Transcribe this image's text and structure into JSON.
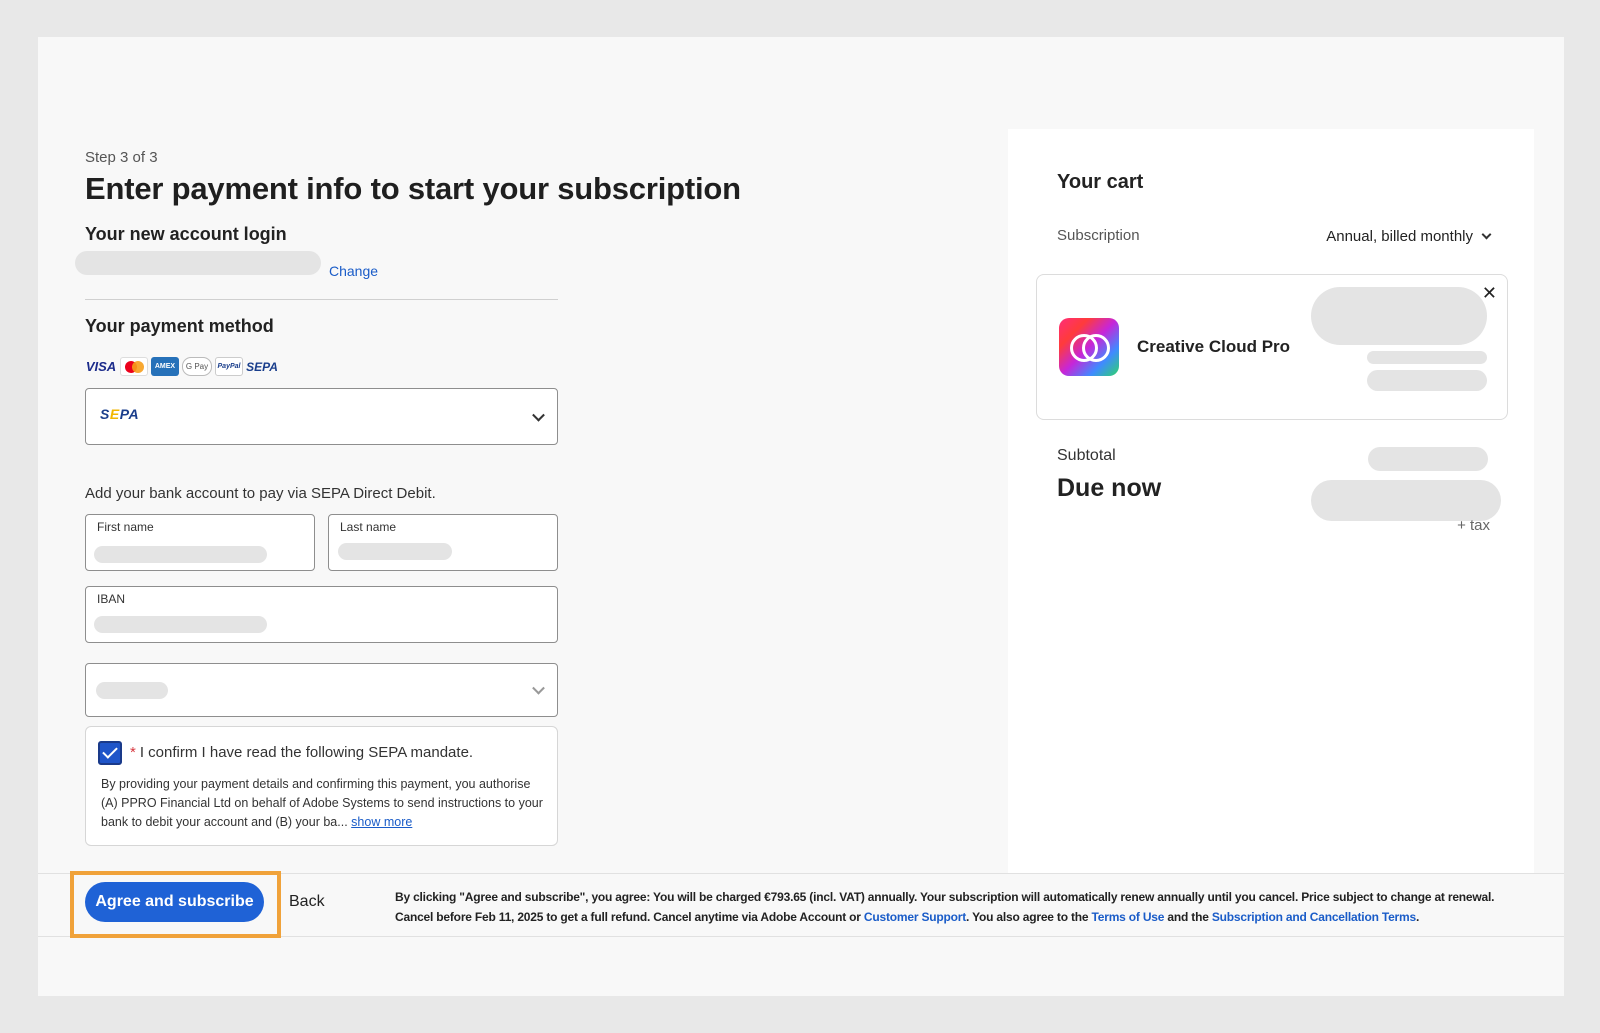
{
  "step": "Step 3 of 3",
  "title": "Enter payment info to start your subscription",
  "account": {
    "heading": "Your new account login",
    "change_label": "Change"
  },
  "payment": {
    "heading": "Your payment method",
    "logos": [
      "VISA",
      "Mastercard",
      "AMEX",
      "G Pay",
      "PayPal",
      "SEPA"
    ],
    "selected_method": "SEPA",
    "description": "Add your bank account to pay via SEPA Direct Debit.",
    "first_name_label": "First name",
    "last_name_label": "Last name",
    "iban_label": "IBAN"
  },
  "mandate": {
    "confirm_text": "I confirm I have read the following SEPA mandate.",
    "required_mark": "*",
    "body": "By providing your payment details and confirming this payment, you authorise (A) PPRO Financial Ltd on behalf of Adobe Systems to send instructions to your bank to debit your account and (B) your ba...",
    "show_more": "show more",
    "checked": true
  },
  "cart": {
    "title": "Your cart",
    "subscription_label": "Subscription",
    "subscription_value": "Annual, billed monthly",
    "product_name": "Creative Cloud Pro",
    "close_glyph": "✕",
    "subtotal_label": "Subtotal",
    "due_label": "Due now",
    "tax_label": "+ tax"
  },
  "footer": {
    "primary_label": "Agree and subscribe",
    "back_label": "Back",
    "legal_1": "By clicking \"Agree and subscribe\", you agree: You will be charged €793.65 (incl. VAT) annually. Your subscription will automatically renew annually until you cancel. Price subject to change at renewal. Cancel before Feb 11, 2025 to get a full refund. Cancel anytime via Adobe Account or ",
    "link_support": "Customer Support",
    "legal_2": ". You also agree to the ",
    "link_terms": "Terms of Use",
    "legal_3": " and the ",
    "link_cancel": "Subscription and Cancellation Terms",
    "legal_4": "."
  },
  "colors": {
    "accent": "#1f62d6",
    "highlight": "#f0a23a",
    "link": "#1a5cc8"
  }
}
